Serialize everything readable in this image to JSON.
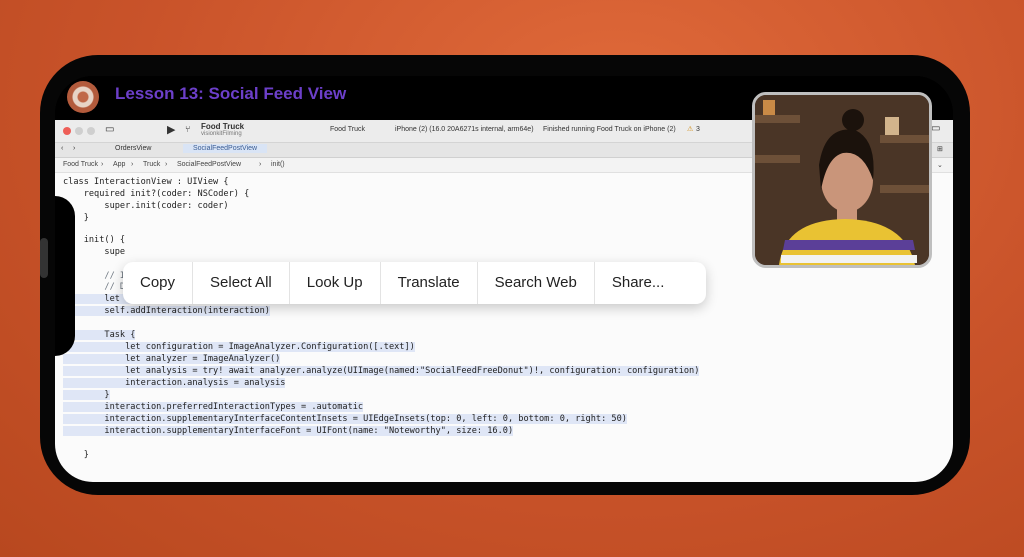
{
  "lesson": {
    "title": "Lesson 13: Social Feed View"
  },
  "xcode": {
    "project_name": "Food Truck",
    "project_subtitle": "visionkitFilming",
    "scheme": "Food Truck",
    "device": "iPhone (2) (16.0 20A6271s internal, arm64e)",
    "status": "Finished running Food Truck on iPhone (2)",
    "warnings": "3",
    "tabs": [
      {
        "label": "OrdersView"
      },
      {
        "label": "SocialFeedPostView"
      }
    ],
    "breadcrumbs": [
      "Food Truck",
      "App",
      "Truck",
      "SocialFeedPostView",
      "init()"
    ]
  },
  "context_menu": {
    "items": [
      {
        "label": "Copy"
      },
      {
        "label": "Select All"
      },
      {
        "label": "Look Up"
      },
      {
        "label": "Translate"
      },
      {
        "label": "Search Web"
      },
      {
        "label": "Share..."
      }
    ]
  },
  "code": {
    "lines": [
      "class InteractionView : UIView {",
      "    required init?(coder: NSCoder) {",
      "        super.init(coder: coder)",
      "    }",
      "",
      "    init() {",
      "        supe",
      "",
      "        // I",
      "        // Devs - use live text to easily copy and paste this code!",
      "        let interaction = ImageAnalysisInteraction()",
      "        self.addInteraction(interaction)",
      "",
      "        Task {",
      "            let configuration = ImageAnalyzer.Configuration([.text])",
      "            let analyzer = ImageAnalyzer()",
      "            let analysis = try! await analyzer.analyze(UIImage(named:\"SocialFeedFreeDonut\")!, configuration: configuration)",
      "            interaction.analysis = analysis",
      "        }",
      "        interaction.preferredInteractionTypes = .automatic",
      "        interaction.supplementaryInterfaceContentInsets = UIEdgeInsets(top: 0, left: 0, bottom: 0, right: 50)",
      "        interaction.supplementaryInterfaceFont = UIFont(name: \"Noteworthy\", size: 16.0)",
      "",
      "    }"
    ]
  },
  "colors": {
    "background": "#c9532a",
    "lesson_title": "#6c3fc9",
    "selection": "#dfe6f6"
  }
}
